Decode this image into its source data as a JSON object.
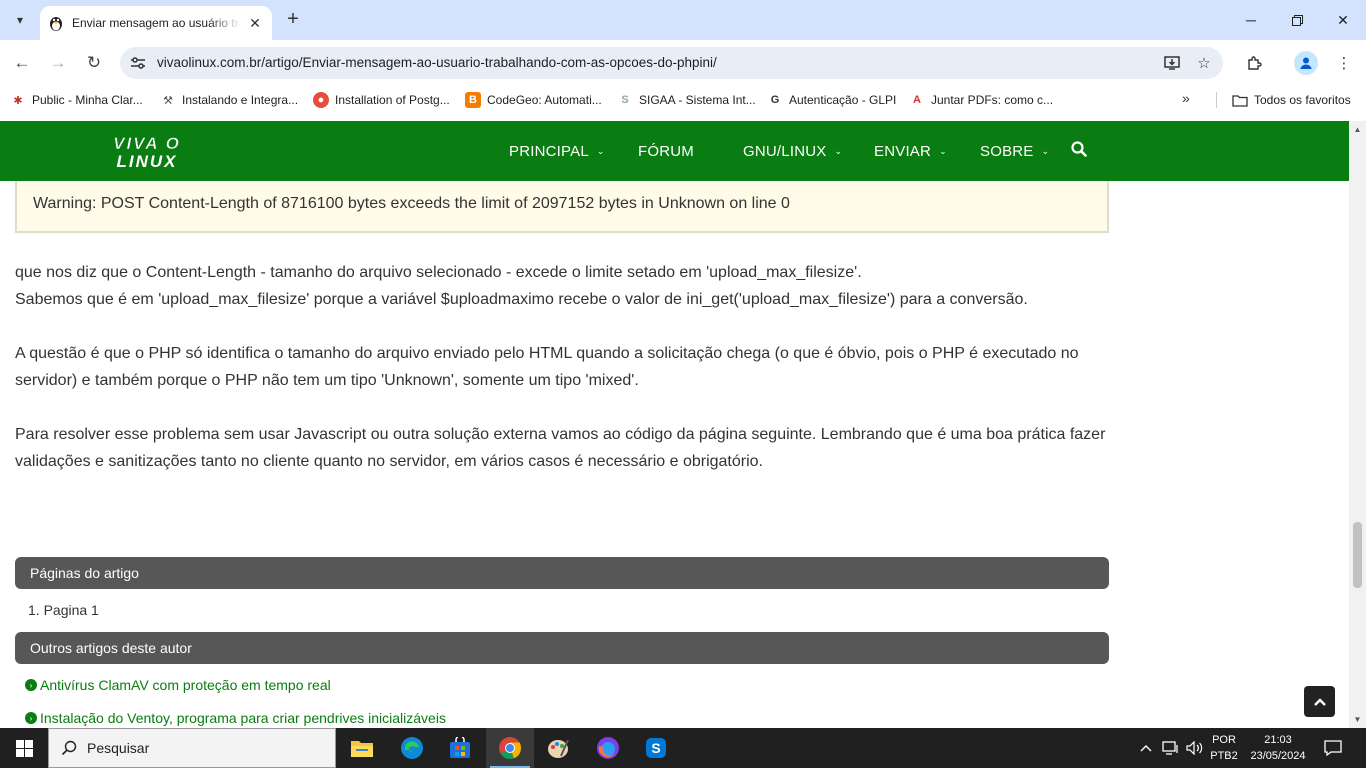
{
  "browser": {
    "tab_title": "Enviar mensagem ao usuário trabalhando com as opções do php.ini",
    "url": "vivaolinux.com.br/artigo/Enviar-mensagem-ao-usuario-trabalhando-com-as-opcoes-do-phpini/",
    "icons": [
      "tab-search-icon",
      "tux-favicon",
      "close-icon",
      "plus-icon",
      "minimize-icon",
      "restore-icon",
      "close-window-icon",
      "back-icon",
      "forward-icon",
      "reload-icon",
      "site-info-icon",
      "install-app-icon",
      "star-icon",
      "extensions-icon",
      "profile-icon",
      "kebab-menu-icon"
    ]
  },
  "bookmarks": {
    "items": [
      {
        "label": "Public - Minha Clar...",
        "icon": "fish-icon",
        "color": "#c0392b"
      },
      {
        "label": "Instalando e Integra...",
        "icon": "tool-icon",
        "color": "#555555"
      },
      {
        "label": "Installation of Postg...",
        "icon": "elephant-icon",
        "color": "#e74c3c"
      },
      {
        "label": "CodeGeo: Automati...",
        "icon": "blogger-icon",
        "color": "#f57c00"
      },
      {
        "label": "SIGAA - Sistema Int...",
        "icon": "sigaa-icon",
        "color": "#90a4ae"
      },
      {
        "label": "Autenticação - GLPI",
        "icon": "glpi-icon",
        "color": "#333333"
      },
      {
        "label": "Juntar PDFs: como c...",
        "icon": "pdf-icon",
        "color": "#d32f2f"
      }
    ],
    "all_bookmarks": "Todos os favoritos"
  },
  "site": {
    "brand_color": "#0a7d12",
    "logo_line1": "VIVA O",
    "logo_line2": "LINUX",
    "menu": [
      {
        "label": "PRINCIPAL",
        "caret": "⌄"
      },
      {
        "label": "FÓRUM",
        "caret": ""
      },
      {
        "label": "GNU/LINUX",
        "caret": "⌄"
      },
      {
        "label": "ENVIAR",
        "caret": "⌄"
      },
      {
        "label": "SOBRE",
        "caret": "⌄"
      }
    ]
  },
  "article": {
    "warning": "Warning: POST Content-Length of 8716100 bytes exceeds the limit of 2097152 bytes in Unknown on line 0",
    "p1_line1": "que nos diz que o Content-Length - tamanho do arquivo selecionado - excede o limite setado em 'upload_max_filesize'.",
    "p1_line2": "Sabemos que é em 'upload_max_filesize' porque a variável $uploadmaximo recebe o valor de ini_get('upload_max_filesize') para a conversão.",
    "p2": "A questão é que o PHP só identifica o tamanho do arquivo enviado pelo HTML quando a solicitação chega (o que é óbvio, pois o PHP é executado no servidor) e também porque o PHP não tem um tipo 'Unknown', somente um tipo 'mixed'.",
    "p3": "Para resolver esse problema sem usar Javascript ou outra solução externa vamos ao código da página seguinte. Lembrando que é uma boa prática fazer validações e sanitizações tanto no cliente quanto no servidor, em vários casos é necessário e obrigatório."
  },
  "pages_section": {
    "title": "Páginas do artigo",
    "items": [
      "1. Pagina 1"
    ]
  },
  "other_articles": {
    "title": "Outros artigos deste autor",
    "items": [
      "Antivírus ClamAV com proteção em tempo real",
      "Instalação do Ventoy, programa para criar pendrives inicializáveis"
    ]
  },
  "taskbar": {
    "search_placeholder": "Pesquisar",
    "language_line1": "POR",
    "language_line2": "PTB2",
    "time": "21:03",
    "date": "23/05/2024",
    "apps": [
      "file-explorer-icon",
      "edge-icon",
      "store-icon",
      "chrome-icon",
      "paint-icon",
      "firefox-icon",
      "skype-icon"
    ]
  }
}
